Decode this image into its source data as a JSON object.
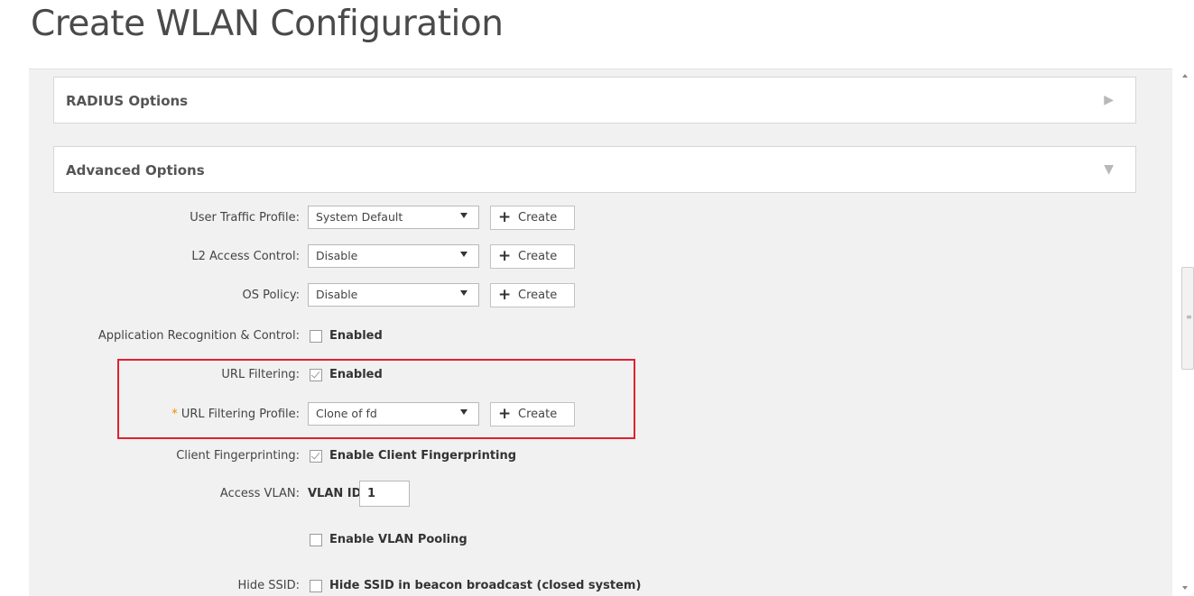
{
  "page": {
    "title": "Create WLAN Configuration"
  },
  "sections": {
    "radius": {
      "title": "RADIUS Options",
      "arrow": "▶"
    },
    "advanced": {
      "title": "Advanced Options",
      "arrow": "▼"
    }
  },
  "fields": {
    "user_traffic_profile": {
      "label": "User Traffic Profile:",
      "value": "System Default",
      "create": "Create"
    },
    "l2_access_control": {
      "label": "L2 Access Control:",
      "value": "Disable",
      "create": "Create"
    },
    "os_policy": {
      "label": "OS Policy:",
      "value": "Disable",
      "create": "Create"
    },
    "app_recognition": {
      "label": "Application Recognition & Control:",
      "checkbox_label": "Enabled",
      "checked": false
    },
    "url_filtering": {
      "label": "URL Filtering:",
      "checkbox_label": "Enabled",
      "checked": true
    },
    "url_filtering_profile": {
      "required_mark": "*",
      "label": "URL Filtering Profile:",
      "value": "Clone of fd",
      "create": "Create"
    },
    "client_fingerprinting": {
      "label": "Client Fingerprinting:",
      "checkbox_label": "Enable Client Fingerprinting",
      "checked": true
    },
    "access_vlan": {
      "label": "Access VLAN:",
      "id_label": "VLAN ID",
      "value": "1"
    },
    "vlan_pooling": {
      "checkbox_label": "Enable VLAN Pooling",
      "checked": false
    },
    "hide_ssid": {
      "label": "Hide SSID:",
      "checkbox_label": "Hide SSID in beacon broadcast (closed system)",
      "checked": false
    }
  },
  "colors": {
    "highlight": "#e0202f",
    "required": "#f08a00",
    "panel_bg": "#f1f1f1"
  },
  "icons": {
    "create": "plus-icon",
    "dropdown": "caret-down-icon",
    "collapsed": "triangle-right-icon",
    "expanded": "triangle-down-icon"
  }
}
